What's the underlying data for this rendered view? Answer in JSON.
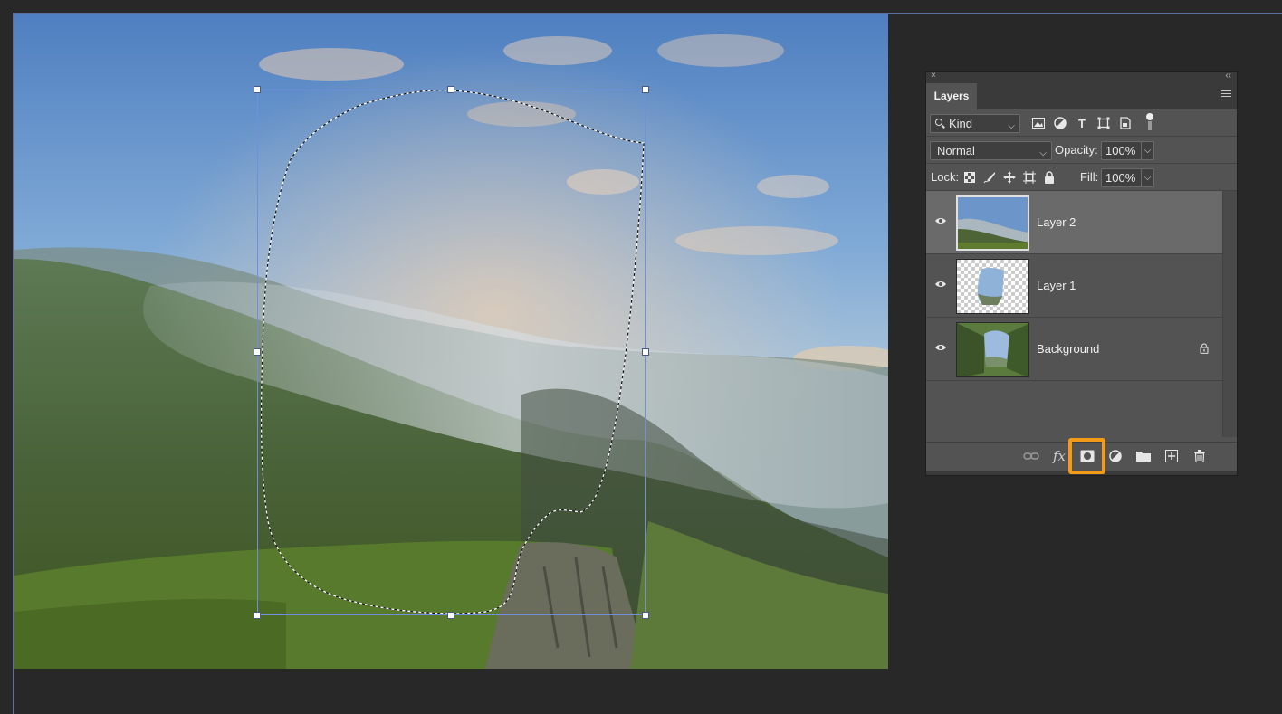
{
  "panel": {
    "close_glyph": "×",
    "collapse_glyph": "‹‹",
    "tab_label": "Layers",
    "menu_icon": "panel-menu-icon"
  },
  "filter": {
    "kind_label": "Kind",
    "icons": [
      "pixel-filter-icon",
      "adjustment-filter-icon",
      "type-filter-icon",
      "shape-filter-icon",
      "smart-object-filter-icon"
    ]
  },
  "blend": {
    "mode": "Normal",
    "opacity_label": "Opacity:",
    "opacity_value": "100%"
  },
  "lock": {
    "label": "Lock:",
    "icons": [
      "lock-transparent-icon",
      "lock-image-icon",
      "lock-position-icon",
      "lock-artboard-icon",
      "lock-all-icon"
    ],
    "fill_label": "Fill:",
    "fill_value": "100%"
  },
  "layers": [
    {
      "name": "Layer 2",
      "selected": true,
      "visible": true,
      "locked": false
    },
    {
      "name": "Layer 1",
      "selected": false,
      "visible": true,
      "locked": false
    },
    {
      "name": "Background",
      "selected": false,
      "visible": true,
      "locked": true
    }
  ],
  "bottom": {
    "link_icon": "link-icon",
    "fx_label": "fx",
    "mask_icon": "add-mask-icon",
    "adjustment_icon": "adjustment-layer-icon",
    "group_icon": "folder-icon",
    "new_layer_icon": "new-layer-icon",
    "delete_icon": "trash-icon"
  },
  "colors": {
    "accent_highlight": "#f39a18",
    "guide": "#5b6fa8",
    "panel_bg": "#535353"
  }
}
